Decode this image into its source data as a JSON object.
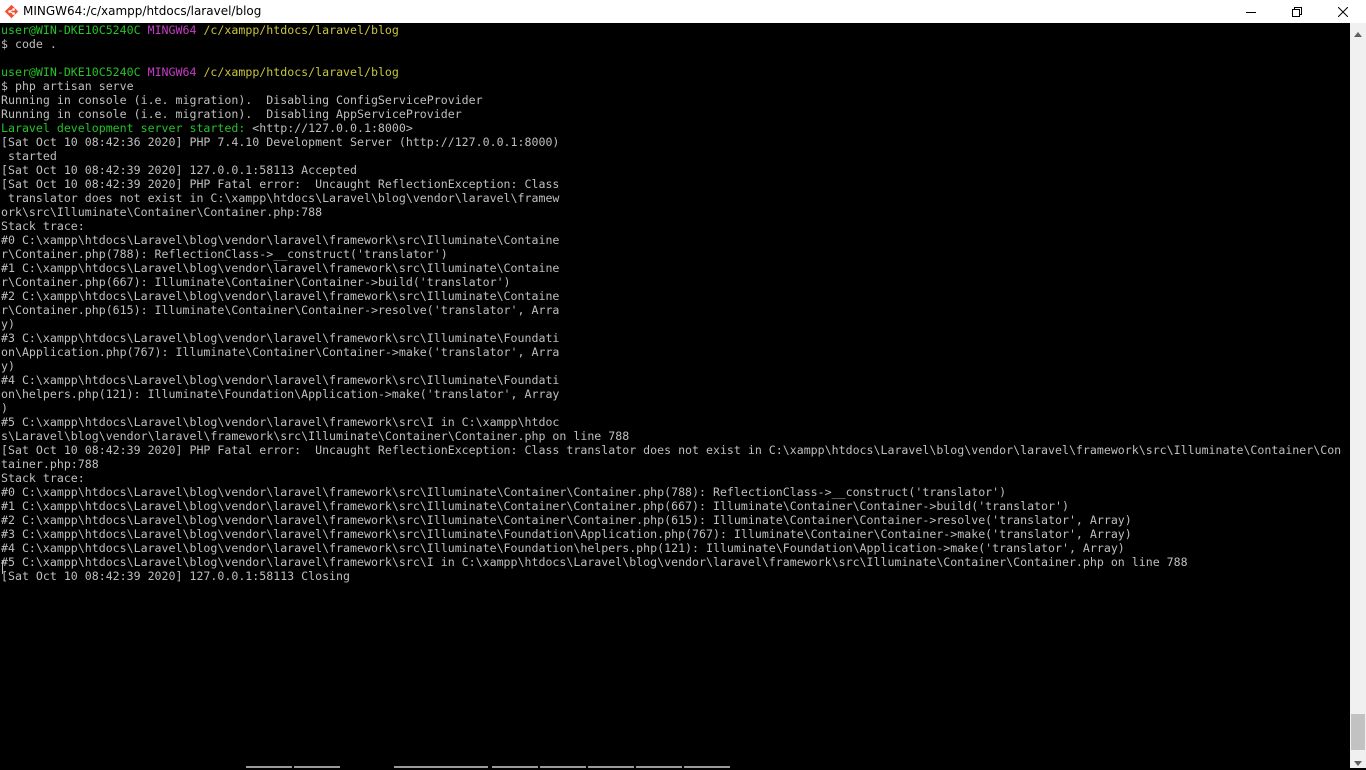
{
  "window": {
    "title": "MINGW64:/c/xampp/htdocs/laravel/blog",
    "app_icon": "git-bash-icon",
    "controls": [
      "minimize-icon",
      "maximize-icon",
      "close-icon"
    ]
  },
  "colors": {
    "background": "#000000",
    "text": "#bfbfbf",
    "user_host": "#25c228",
    "msystem": "#c63cc6",
    "path": "#c7c43a",
    "started": "#25c228"
  },
  "terminal": {
    "blocks": [
      {
        "user": "user@WIN-DKE10C5240C",
        "msystem": "MINGW64",
        "path": "/c/xampp/htdocs/laravel/blog",
        "command": "$ code ."
      },
      {
        "user": "user@WIN-DKE10C5240C",
        "msystem": "MINGW64",
        "path": "/c/xampp/htdocs/laravel/blog",
        "command": "$ php artisan serve"
      }
    ],
    "out1": "Running in console (i.e. migration).  Disabling ConfigServiceProvider\nRunning in console (i.e. migration).  Disabling AppServiceProvider",
    "started_label": "Laravel development server started:",
    "started_url": " <http://127.0.0.1:8000>",
    "out2": "[Sat Oct 10 08:42:36 2020] PHP 7.4.10 Development Server (http://127.0.0.1:8000)\n started\n[Sat Oct 10 08:42:39 2020] 127.0.0.1:58113 Accepted\n[Sat Oct 10 08:42:39 2020] PHP Fatal error:  Uncaught ReflectionException: Class\n translator does not exist in C:\\xampp\\htdocs\\Laravel\\blog\\vendor\\laravel\\framew\nork\\src\\Illuminate\\Container\\Container.php:788\nStack trace:\n#0 C:\\xampp\\htdocs\\Laravel\\blog\\vendor\\laravel\\framework\\src\\Illuminate\\Containe\nr\\Container.php(788): ReflectionClass->__construct('translator')\n#1 C:\\xampp\\htdocs\\Laravel\\blog\\vendor\\laravel\\framework\\src\\Illuminate\\Containe\nr\\Container.php(667): Illuminate\\Container\\Container->build('translator')\n#2 C:\\xampp\\htdocs\\Laravel\\blog\\vendor\\laravel\\framework\\src\\Illuminate\\Containe\nr\\Container.php(615): Illuminate\\Container\\Container->resolve('translator', Arra\ny)\n#3 C:\\xampp\\htdocs\\Laravel\\blog\\vendor\\laravel\\framework\\src\\Illuminate\\Foundati\non\\Application.php(767): Illuminate\\Container\\Container->make('translator', Arra\ny)\n#4 C:\\xampp\\htdocs\\Laravel\\blog\\vendor\\laravel\\framework\\src\\Illuminate\\Foundati\non\\helpers.php(121): Illuminate\\Foundation\\Application->make('translator', Array\n)\n#5 C:\\xampp\\htdocs\\Laravel\\blog\\vendor\\laravel\\framework\\src\\I in C:\\xampp\\htdoc\ns\\Laravel\\blog\\vendor\\laravel\\framework\\src\\Illuminate\\Container\\Container.php on line 788\n[Sat Oct 10 08:42:39 2020] PHP Fatal error:  Uncaught ReflectionException: Class translator does not exist in C:\\xampp\\htdocs\\Laravel\\blog\\vendor\\laravel\\framework\\src\\Illuminate\\Container\\Con\ntainer.php:788\nStack trace:\n#0 C:\\xampp\\htdocs\\Laravel\\blog\\vendor\\laravel\\framework\\src\\Illuminate\\Container\\Container.php(788): ReflectionClass->__construct('translator')\n#1 C:\\xampp\\htdocs\\Laravel\\blog\\vendor\\laravel\\framework\\src\\Illuminate\\Container\\Container.php(667): Illuminate\\Container\\Container->build('translator')\n#2 C:\\xampp\\htdocs\\Laravel\\blog\\vendor\\laravel\\framework\\src\\Illuminate\\Container\\Container.php(615): Illuminate\\Container\\Container->resolve('translator', Array)\n#3 C:\\xampp\\htdocs\\Laravel\\blog\\vendor\\laravel\\framework\\src\\Illuminate\\Foundation\\Application.php(767): Illuminate\\Container\\Container->make('translator', Array)\n#4 C:\\xampp\\htdocs\\Laravel\\blog\\vendor\\laravel\\framework\\src\\Illuminate\\Foundation\\helpers.php(121): Illuminate\\Foundation\\Application->make('translator', Array)\n#5 C:\\xampp\\htdocs\\Laravel\\blog\\vendor\\laravel\\framework\\src\\I in C:\\xampp\\htdocs\\Laravel\\blog\\vendor\\laravel\\framework\\src\\Illuminate\\Container\\Container.php on line 788\n[Sat Oct 10 08:42:39 2020] 127.0.0.1:58113 Closing"
  }
}
